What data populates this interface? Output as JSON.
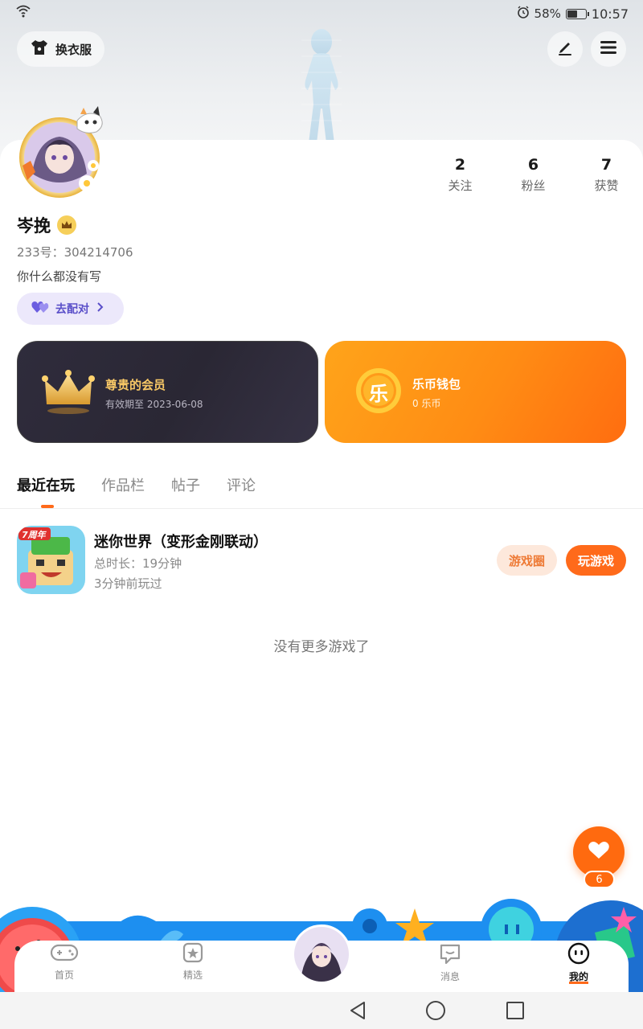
{
  "status_bar": {
    "battery_percent_label": "58%",
    "battery_level": 0.58,
    "time": "10:57"
  },
  "header": {
    "outfit_label": "换衣服"
  },
  "profile": {
    "stats": [
      {
        "num": "2",
        "label": "关注"
      },
      {
        "num": "6",
        "label": "粉丝"
      },
      {
        "num": "7",
        "label": "获赞"
      }
    ],
    "name": "岑挽",
    "uid": "233号：304214706",
    "bio": "你什么都没有写",
    "match_label": "去配对"
  },
  "vip": {
    "title": "尊贵的会员",
    "subtitle": "有效期至 2023-06-08"
  },
  "wallet": {
    "title": "乐币钱包",
    "subtitle": "0 乐币",
    "coin_glyph": "乐"
  },
  "tabs": [
    "最近在玩",
    "作品栏",
    "帖子",
    "评论"
  ],
  "game": {
    "title": "迷你世界（变形金刚联动）",
    "duration": "总时长：19分钟",
    "last_played": "3分钟前玩过",
    "circle_label": "游戏圈",
    "play_label": "玩游戏",
    "icon_badge": "7周年"
  },
  "no_more": "没有更多游戏了",
  "like_count": "6",
  "bottom_nav": [
    {
      "label": "首页"
    },
    {
      "label": "精选"
    },
    {
      "label": "消息"
    },
    {
      "label": "我的"
    }
  ],
  "colors": {
    "accent": "#ff6a1a",
    "vip_gold": "#f8c866",
    "match_purple": "#5a4fc9"
  }
}
